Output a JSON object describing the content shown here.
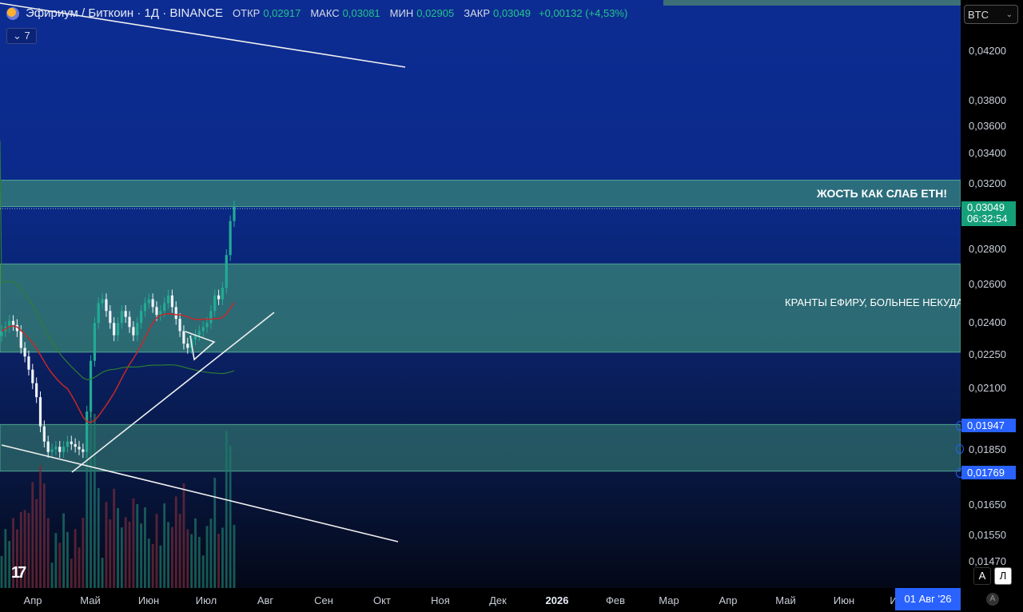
{
  "legend": {
    "symbol": "Эфириум / Биткоин · 1Д · BINANCE",
    "open_label": "ОТКР",
    "open": "0,02917",
    "high_label": "МАКС",
    "high": "0,03081",
    "low_label": "МИН",
    "low": "0,02905",
    "close_label": "ЗАКР",
    "close": "0,03049",
    "change": "+0,00132 (+4,53%)"
  },
  "indicators_count": "7",
  "currency": "BTC",
  "price_axis": [
    "0,04200",
    "0,03800",
    "0,03600",
    "0,03400",
    "0,03200",
    "0,02800",
    "0,02600",
    "0,02400",
    "0,02250",
    "0,02100",
    "0,01850",
    "0,01650",
    "0,01550",
    "0,01470"
  ],
  "last_price": {
    "price": "0,03049",
    "countdown": "06:32:54"
  },
  "level_tags": [
    "0,01947",
    "0,01769"
  ],
  "zone_labels": {
    "top": "ЖОСТЬ КАК СЛАБ ETH!",
    "middle": "КРАНТЫ ЕФИРУ, БОЛЬНЕЕ НЕКУДА"
  },
  "time_axis": [
    "Апр",
    "Май",
    "Июн",
    "Июл",
    "Авг",
    "Сен",
    "Окт",
    "Ноя",
    "Дек",
    "2026",
    "Фев",
    "Мар",
    "Апр",
    "Май",
    "Июн",
    "И"
  ],
  "cursor_date": "01 Авг '26",
  "scale_buttons": [
    "A",
    "Л"
  ],
  "axis_corner": "A",
  "colors": {
    "up": "#22ab94",
    "down": "#f0f3fa",
    "zone": "#3b8a78",
    "ma_red": "#c62828",
    "ma_green": "#2e7d32",
    "accent": "#2962ff"
  },
  "chart_data": {
    "type": "candlestick",
    "symbol": "ETHBTC",
    "interval": "1D",
    "log_scale": true,
    "ylim": [
      0.0147,
      0.0435
    ],
    "zones": [
      {
        "from": 0.0305,
        "to": 0.0322,
        "label": "ЖОСТЬ КАК СЛАБ ETH!"
      },
      {
        "from": 0.0226,
        "to": 0.0271,
        "label": "КРАНТЫ ЕФИРУ, БОЛЬНЕЕ НЕКУДА"
      },
      {
        "from": 0.01769,
        "to": 0.01947
      }
    ],
    "closes": [
      0.0236,
      0.0238,
      0.0241,
      0.0239,
      0.0236,
      0.0228,
      0.0224,
      0.0218,
      0.0212,
      0.0206,
      0.0194,
      0.0188,
      0.0184,
      0.0185,
      0.0186,
      0.0184,
      0.0186,
      0.0188,
      0.0187,
      0.0186,
      0.0185,
      0.0184,
      0.02,
      0.0222,
      0.024,
      0.025,
      0.0252,
      0.0246,
      0.024,
      0.0234,
      0.024,
      0.0246,
      0.0243,
      0.0238,
      0.0234,
      0.024,
      0.0246,
      0.025,
      0.0252,
      0.0248,
      0.0244,
      0.0246,
      0.025,
      0.0254,
      0.0248,
      0.0242,
      0.0236,
      0.023,
      0.0228,
      0.0232,
      0.0234,
      0.0236,
      0.0238,
      0.024,
      0.0246,
      0.0254,
      0.0252,
      0.0258,
      0.0276,
      0.0296,
      0.0305
    ],
    "volume_spikes": [
      0.0305
    ]
  }
}
